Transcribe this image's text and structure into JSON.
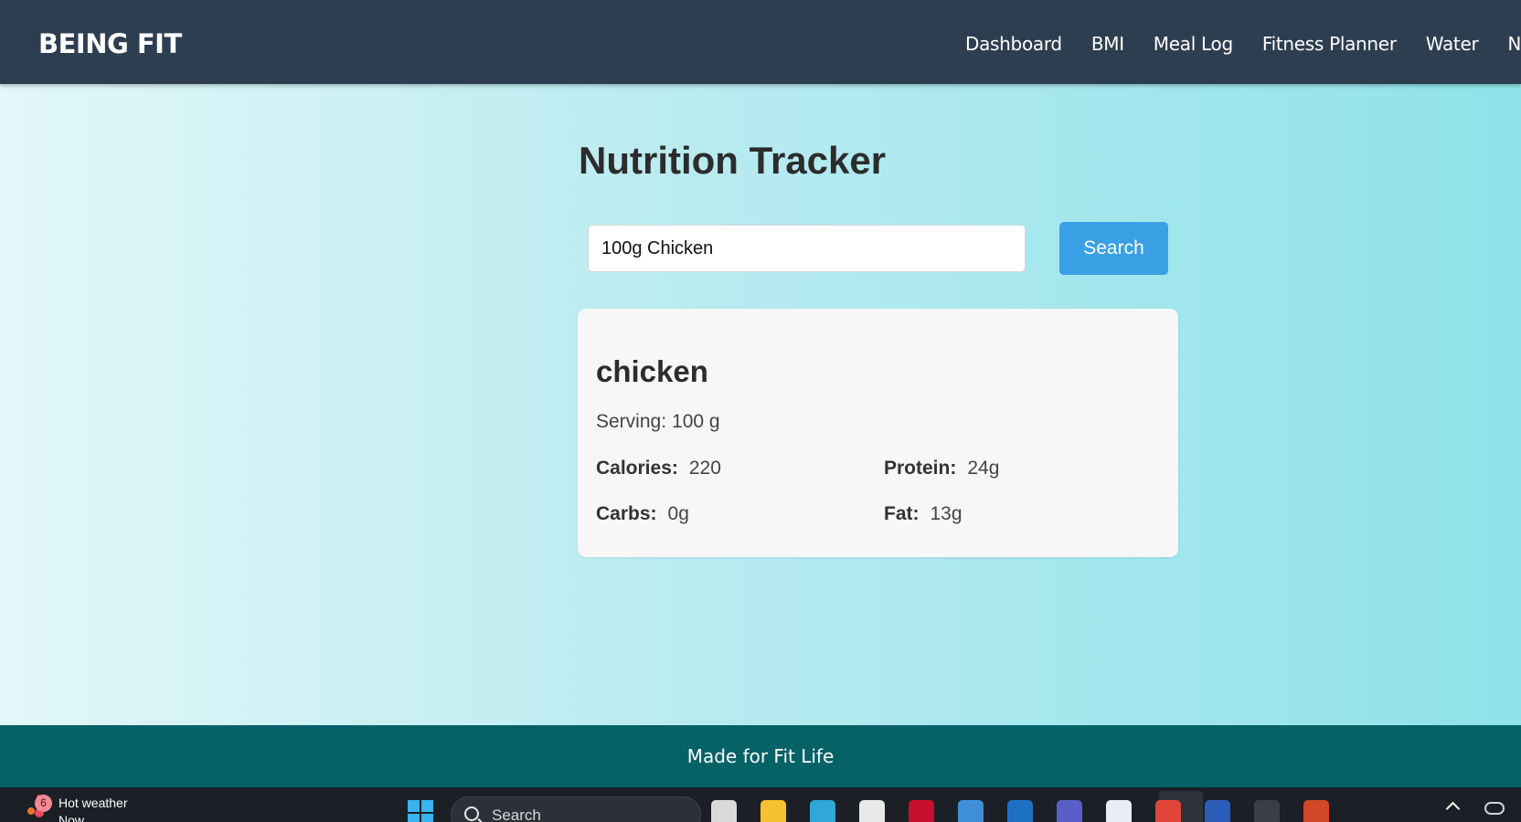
{
  "navbar": {
    "brand": "BEING FIT",
    "links": [
      "Dashboard",
      "BMI",
      "Meal Log",
      "Fitness Planner",
      "Water",
      "Nu"
    ]
  },
  "main": {
    "title": "Nutrition Tracker",
    "search": {
      "value": "100g Chicken",
      "button_label": "Search"
    },
    "result": {
      "food_name": "chicken",
      "serving_label": "Serving:",
      "serving_value": "100 g",
      "nutrients": [
        {
          "label": "Calories:",
          "value": "220"
        },
        {
          "label": "Protein:",
          "value": "24g"
        },
        {
          "label": "Carbs:",
          "value": "0g"
        },
        {
          "label": "Fat:",
          "value": "13g"
        }
      ]
    }
  },
  "footer": {
    "text": "Made for Fit Life"
  },
  "taskbar": {
    "weather_badge": "6",
    "weather_text": "Hot weather",
    "weather_sub": "Now",
    "search_placeholder": "Search",
    "apps": [
      {
        "name": "task-view-icon",
        "color": "#d9d9d9"
      },
      {
        "name": "file-explorer-icon",
        "color": "#f5c12e"
      },
      {
        "name": "edge-icon",
        "color": "#2fa8d8"
      },
      {
        "name": "store-icon",
        "color": "#e8e8e8"
      },
      {
        "name": "mcafee-icon",
        "color": "#c8102e"
      },
      {
        "name": "azure-icon",
        "color": "#3e8fd8"
      },
      {
        "name": "outlook-icon",
        "color": "#1f6fc5"
      },
      {
        "name": "teams-icon",
        "color": "#5a5fc7"
      },
      {
        "name": "app-a-icon",
        "color": "#e8eef7"
      },
      {
        "name": "chrome-icon",
        "color": "#e0453a"
      },
      {
        "name": "word-icon",
        "color": "#2b5cb8"
      },
      {
        "name": "terminal-icon",
        "color": "#3a3f46"
      },
      {
        "name": "powerpoint-icon",
        "color": "#d24726"
      }
    ]
  }
}
